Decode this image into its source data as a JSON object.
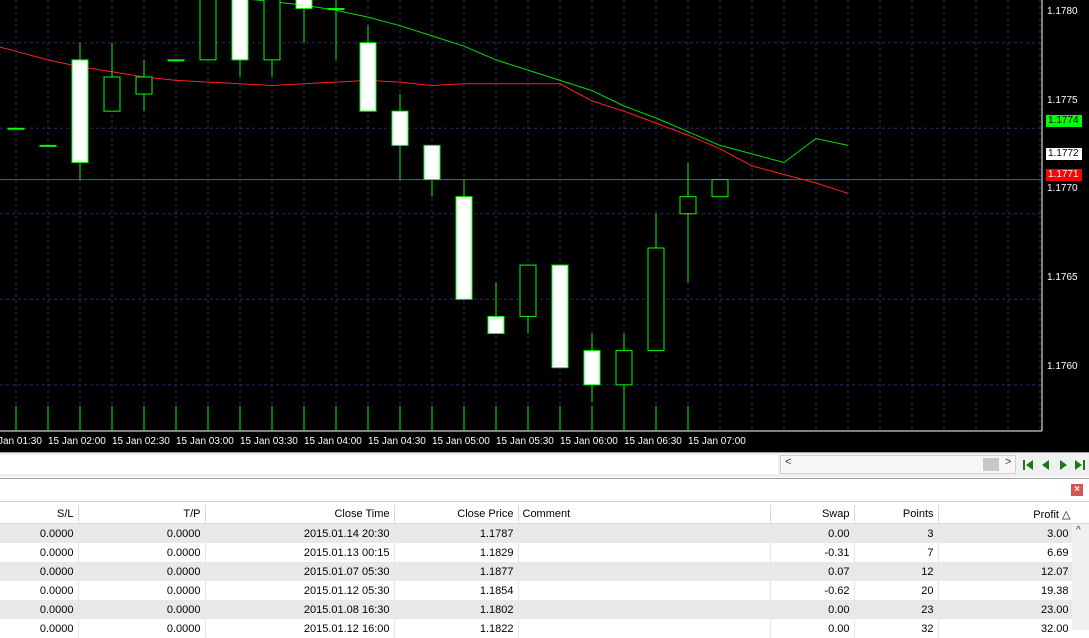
{
  "chart": {
    "price_labels": [
      "1.1780",
      "1.1775",
      "1.1770",
      "1.1765",
      "1.1760"
    ],
    "current_price": "1.1772",
    "green_ma_value": "1.1774",
    "red_ma_value": "1.1771",
    "time_labels": [
      "Jan 01:30",
      "15 Jan 02:00",
      "15 Jan 02:30",
      "15 Jan 03:00",
      "15 Jan 03:30",
      "15 Jan 04:00",
      "15 Jan 04:30",
      "15 Jan 05:00",
      "15 Jan 05:30",
      "15 Jan 06:00",
      "15 Jan 06:30",
      "15 Jan 07:00"
    ],
    "colors": {
      "background": "#000000",
      "candle": "#00ff00",
      "bear_body": "#ffffff",
      "green_ma": "#00dd00",
      "red_ma": "#ff2020",
      "grid": "#2a2a6a",
      "price_line": "#5a5aa0"
    },
    "ylim": [
      1.17573,
      1.17825
    ],
    "candles": [
      {
        "o": 1.1775,
        "h": 1.1775,
        "l": 1.1775,
        "c": 1.1775
      },
      {
        "o": 1.1774,
        "h": 1.1774,
        "l": 1.1774,
        "c": 1.1774
      },
      {
        "o": 1.1779,
        "h": 1.178,
        "l": 1.1772,
        "c": 1.1773
      },
      {
        "o": 1.1776,
        "h": 1.178,
        "l": 1.1776,
        "c": 1.1778
      },
      {
        "o": 1.1777,
        "h": 1.1779,
        "l": 1.1776,
        "c": 1.1778
      },
      {
        "o": 1.1779,
        "h": 1.1779,
        "l": 1.1779,
        "c": 1.1779
      },
      {
        "o": 1.1779,
        "h": 1.1783,
        "l": 1.1779,
        "c": 1.1783
      },
      {
        "o": 1.1783,
        "h": 1.1783,
        "l": 1.1778,
        "c": 1.1779
      },
      {
        "o": 1.1779,
        "h": 1.1783,
        "l": 1.1778,
        "c": 1.1783
      },
      {
        "o": 1.1783,
        "h": 1.1783,
        "l": 1.178,
        "c": 1.1782
      },
      {
        "o": 1.1782,
        "h": 1.1783,
        "l": 1.1779,
        "c": 1.1782
      },
      {
        "o": 1.178,
        "h": 1.1781,
        "l": 1.1776,
        "c": 1.1776
      },
      {
        "o": 1.1776,
        "h": 1.1777,
        "l": 1.1772,
        "c": 1.1774
      },
      {
        "o": 1.1774,
        "h": 1.1774,
        "l": 1.1771,
        "c": 1.1772
      },
      {
        "o": 1.1771,
        "h": 1.1772,
        "l": 1.1765,
        "c": 1.1765
      },
      {
        "o": 1.1764,
        "h": 1.1766,
        "l": 1.1763,
        "c": 1.1763
      },
      {
        "o": 1.1764,
        "h": 1.1767,
        "l": 1.1763,
        "c": 1.1767
      },
      {
        "o": 1.1767,
        "h": 1.1767,
        "l": 1.1761,
        "c": 1.1761
      },
      {
        "o": 1.1762,
        "h": 1.1763,
        "l": 1.1759,
        "c": 1.176
      },
      {
        "o": 1.176,
        "h": 1.1763,
        "l": 1.1758,
        "c": 1.1762
      },
      {
        "o": 1.1762,
        "h": 1.177,
        "l": 1.1762,
        "c": 1.1768
      },
      {
        "o": 1.177,
        "h": 1.1773,
        "l": 1.1766,
        "c": 1.1771
      },
      {
        "o": 1.1771,
        "h": 1.1772,
        "l": 1.1771,
        "c": 1.1772
      }
    ],
    "green_ma": [
      1.1784,
      1.17838,
      1.17836,
      1.17834,
      1.17832,
      1.1783,
      1.17829,
      1.17828,
      1.17826,
      1.17824,
      1.17822,
      1.17819,
      1.17815,
      1.1781,
      1.17804,
      1.17798,
      1.1779,
      1.17784,
      1.17778,
      1.17772,
      1.17763,
      1.17756,
      1.17748,
      1.1774,
      1.17735,
      1.1773,
      1.17744,
      1.1774
    ],
    "red_ma": [
      1.178,
      1.17795,
      1.1779,
      1.17786,
      1.17783,
      1.1778,
      1.17778,
      1.17777,
      1.17776,
      1.17775,
      1.17776,
      1.17777,
      1.17778,
      1.17777,
      1.17775,
      1.17776,
      1.17776,
      1.17776,
      1.17776,
      1.17766,
      1.1776,
      1.17753,
      1.17746,
      1.17738,
      1.17728,
      1.17723,
      1.17718,
      1.17712
    ]
  },
  "scroll": {
    "left_arrow": "<",
    "right_arrow": ">"
  },
  "terminal": {
    "close_label": "×",
    "columns": [
      "S/L",
      "T/P",
      "Close Time",
      "Close Price",
      "Comment",
      "Swap",
      "Points",
      "Profit △"
    ],
    "rows": [
      {
        "sl": "0.0000",
        "tp": "0.0000",
        "close_time": "2015.01.14 20:30",
        "close_price": "1.1787",
        "comment": "",
        "swap": "0.00",
        "points": "3",
        "profit": "3.00"
      },
      {
        "sl": "0.0000",
        "tp": "0.0000",
        "close_time": "2015.01.13 00:15",
        "close_price": "1.1829",
        "comment": "",
        "swap": "-0.31",
        "points": "7",
        "profit": "6.69"
      },
      {
        "sl": "0.0000",
        "tp": "0.0000",
        "close_time": "2015.01.07 05:30",
        "close_price": "1.1877",
        "comment": "",
        "swap": "0.07",
        "points": "12",
        "profit": "12.07"
      },
      {
        "sl": "0.0000",
        "tp": "0.0000",
        "close_time": "2015.01.12 05:30",
        "close_price": "1.1854",
        "comment": "",
        "swap": "-0.62",
        "points": "20",
        "profit": "19.38"
      },
      {
        "sl": "0.0000",
        "tp": "0.0000",
        "close_time": "2015.01.08 16:30",
        "close_price": "1.1802",
        "comment": "",
        "swap": "0.00",
        "points": "23",
        "profit": "23.00"
      },
      {
        "sl": "0.0000",
        "tp": "0.0000",
        "close_time": "2015.01.12 16:00",
        "close_price": "1.1822",
        "comment": "",
        "swap": "0.00",
        "points": "32",
        "profit": "32.00"
      }
    ],
    "scroll_up": "^"
  }
}
